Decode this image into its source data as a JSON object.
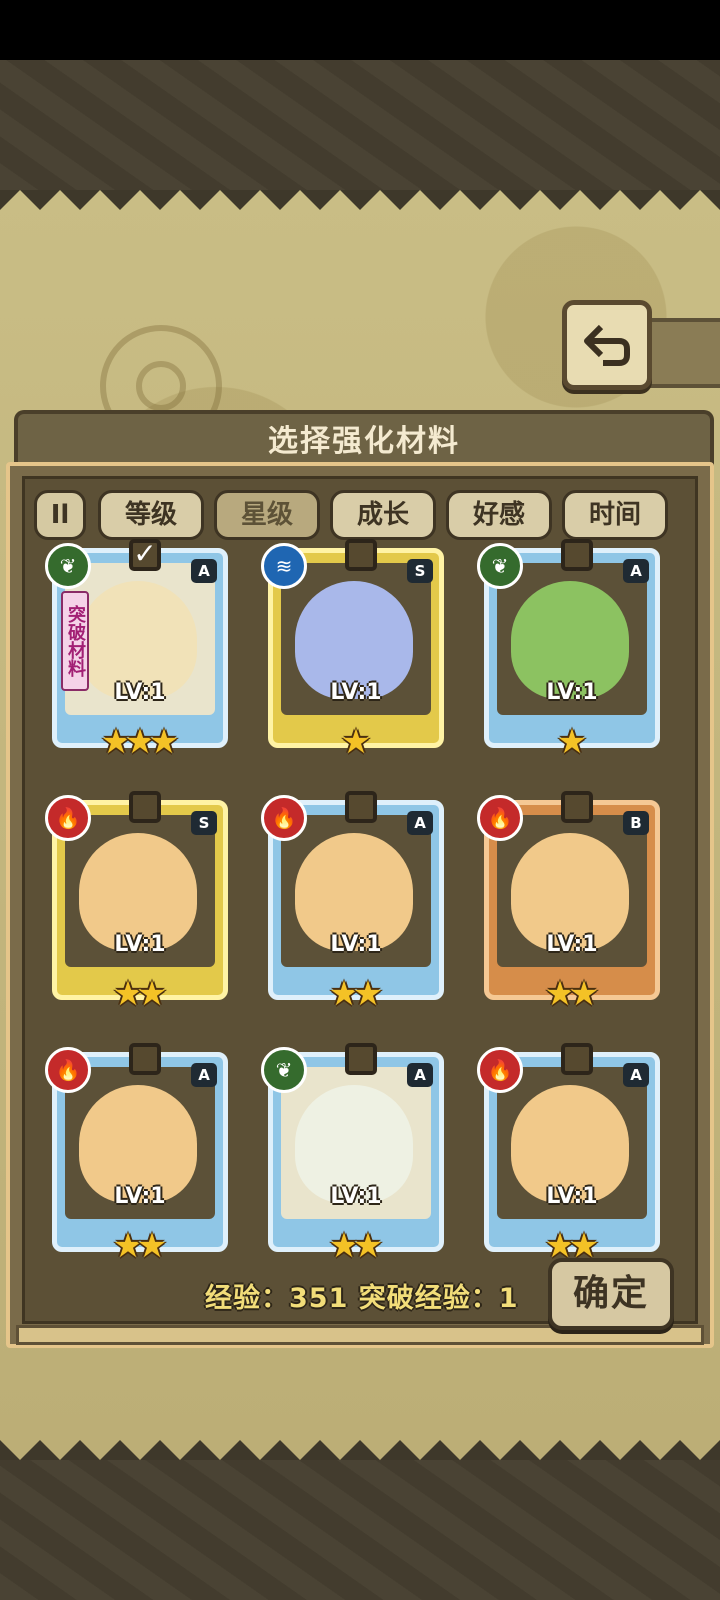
{
  "panel": {
    "title": "选择强化材料"
  },
  "sort_toggle": {
    "label": "Il"
  },
  "tabs": [
    {
      "label": "等级",
      "active": false
    },
    {
      "label": "星级",
      "active": true
    },
    {
      "label": "成长",
      "active": false
    },
    {
      "label": "好感",
      "active": false
    },
    {
      "label": "时间",
      "active": false
    }
  ],
  "cards": [
    {
      "element": "nature",
      "element_icon": "leaf-icon",
      "rarity": "A",
      "level": "LV:1",
      "stars": 3,
      "checked": true,
      "tag": "突破材料",
      "character": "horned-girl"
    },
    {
      "element": "water",
      "element_icon": "wave-icon",
      "rarity": "S",
      "level": "LV:1",
      "stars": 1,
      "checked": false,
      "tag": "",
      "character": "blue-blob"
    },
    {
      "element": "nature",
      "element_icon": "leaf-icon",
      "rarity": "A",
      "level": "LV:1",
      "stars": 1,
      "checked": false,
      "tag": "",
      "character": "green-slime"
    },
    {
      "element": "fire",
      "element_icon": "flame-icon",
      "rarity": "S",
      "level": "LV:1",
      "stars": 2,
      "checked": false,
      "tag": "",
      "character": "pudding"
    },
    {
      "element": "fire",
      "element_icon": "flame-icon",
      "rarity": "A",
      "level": "LV:1",
      "stars": 2,
      "checked": false,
      "tag": "",
      "character": "pudding"
    },
    {
      "element": "fire",
      "element_icon": "flame-icon",
      "rarity": "B",
      "level": "LV:1",
      "stars": 2,
      "checked": false,
      "tag": "",
      "character": "pudding"
    },
    {
      "element": "fire",
      "element_icon": "flame-icon",
      "rarity": "A",
      "level": "LV:1",
      "stars": 2,
      "checked": false,
      "tag": "",
      "character": "pudding"
    },
    {
      "element": "nature",
      "element_icon": "leaf-icon",
      "rarity": "A",
      "level": "LV:1",
      "stars": 2,
      "checked": false,
      "tag": "",
      "character": "white-hair-girl"
    },
    {
      "element": "fire",
      "element_icon": "flame-icon",
      "rarity": "A",
      "level": "LV:1",
      "stars": 2,
      "checked": false,
      "tag": "",
      "character": "pudding"
    }
  ],
  "footer": {
    "experience_text": "经验：351 突破经验：1",
    "confirm_label": "确定"
  },
  "colors": {
    "fire": "#c42a2a",
    "nature": "#356b2d",
    "water": "#1f66b2",
    "star": "#f4c226",
    "exp_text": "#f2dd79"
  }
}
